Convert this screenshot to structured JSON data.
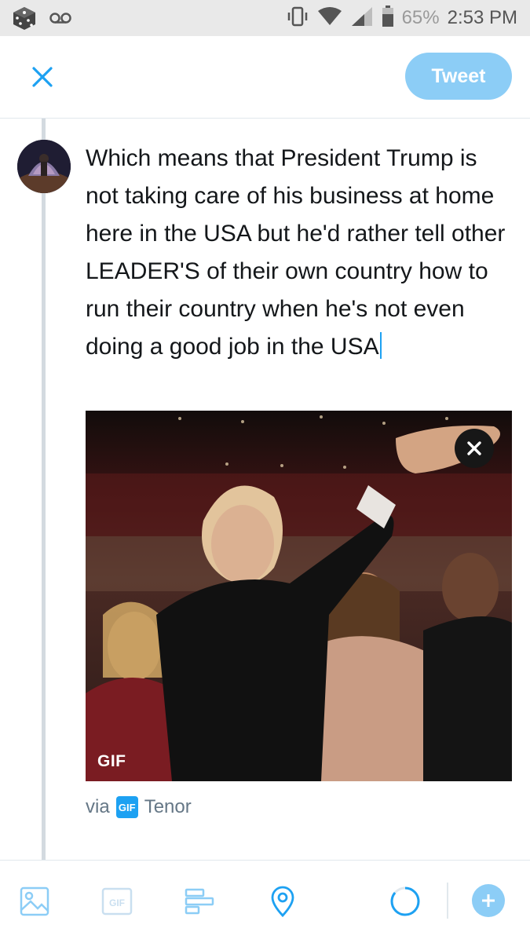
{
  "status_bar": {
    "battery_percent": "65%",
    "time": "2:53 PM",
    "icons": [
      "dice-icon",
      "voicemail-icon",
      "vibrate-icon",
      "wifi-icon",
      "signal-icon",
      "battery-icon"
    ]
  },
  "header": {
    "close_icon": "close-icon",
    "tweet_label": "Tweet"
  },
  "compose": {
    "text": "Which means that President Trump is not taking care of his business at home here in the USA but he'd rather tell other LEADER'S of their own country how to run their country when he's not even doing a good job in the USA"
  },
  "gif": {
    "badge": "GIF",
    "attribution_prefix": "via",
    "attribution_icon_text": "GIF",
    "attribution_source": "Tenor"
  },
  "toolbar": {
    "items": [
      "image-icon",
      "gif-icon",
      "poll-icon",
      "location-icon",
      "character-counter-icon",
      "add-tweet-icon"
    ]
  },
  "colors": {
    "accent": "#1da1f2",
    "accent_disabled": "#8ccdf6",
    "text": "#14171a",
    "secondary_text": "#657786"
  }
}
